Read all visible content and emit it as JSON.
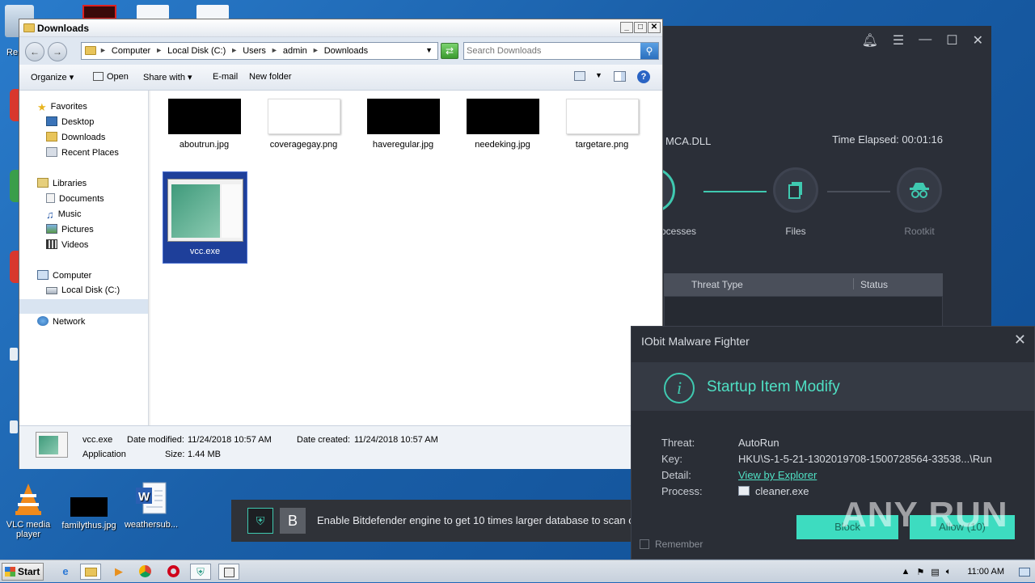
{
  "desktop": {
    "icons": [
      {
        "label": "VLC media player"
      },
      {
        "label": "familythus.jpg"
      },
      {
        "label": "weathersub..."
      }
    ],
    "edge_labels": [
      "Re"
    ]
  },
  "explorer": {
    "title": "Downloads",
    "breadcrumbs": [
      "Computer",
      "Local Disk (C:)",
      "Users",
      "admin",
      "Downloads"
    ],
    "search_placeholder": "Search Downloads",
    "commands": [
      "Organize",
      "Open",
      "Share with",
      "E-mail",
      "New folder"
    ],
    "nav": {
      "favorites": "Favorites",
      "desktop": "Desktop",
      "downloads": "Downloads",
      "recent": "Recent Places",
      "libraries": "Libraries",
      "documents": "Documents",
      "music": "Music",
      "pictures": "Pictures",
      "videos": "Videos",
      "computer": "Computer",
      "local_disk": "Local Disk (C:)",
      "network": "Network"
    },
    "files": [
      {
        "name": "aboutrun.jpg"
      },
      {
        "name": "coveragegay.png"
      },
      {
        "name": "haveregular.jpg"
      },
      {
        "name": "needeking.jpg"
      },
      {
        "name": "targetare.png"
      },
      {
        "name": "vcc.exe"
      }
    ],
    "details": {
      "name": "vcc.exe",
      "type": "Application",
      "modified_label": "Date modified:",
      "modified": "11/24/2018 10:57 AM",
      "created_label": "Date created:",
      "created": "11/24/2018 10:57 AM",
      "size_label": "Size:",
      "size": "1.44 MB"
    }
  },
  "iobit": {
    "scan_item": "MCA.DLL",
    "time_elapsed": "Time Elapsed: 00:01:16",
    "steps": [
      "ocesses",
      "Files",
      "Rootkit"
    ],
    "table_headers": [
      "Threat Type",
      "Status"
    ]
  },
  "bitdefender": {
    "b_label": "B",
    "message": "Enable Bitdefender engine to get 10 times larger database to scan c"
  },
  "popup": {
    "title": "IObit Malware Fighter",
    "heading": "Startup Item Modify",
    "threat_label": "Threat:",
    "threat": "AutoRun",
    "key_label": "Key:",
    "key": "HKU\\S-1-5-21-1302019708-1500728564-33538...\\Run",
    "detail_label": "Detail:",
    "detail": "View by Explorer",
    "process_label": "Process:",
    "process": "cleaner.exe",
    "block_label": "Block",
    "allow_label": "Allow (10)",
    "remember_label": "Remember"
  },
  "watermark": "ANY RUN",
  "taskbar": {
    "start_label": "Start",
    "clock": "11:00 AM"
  },
  "colors": {
    "iobit_accent": "#3ddcc0",
    "iobit_bg": "#2b2f38",
    "selection": "#1e3f9a"
  }
}
